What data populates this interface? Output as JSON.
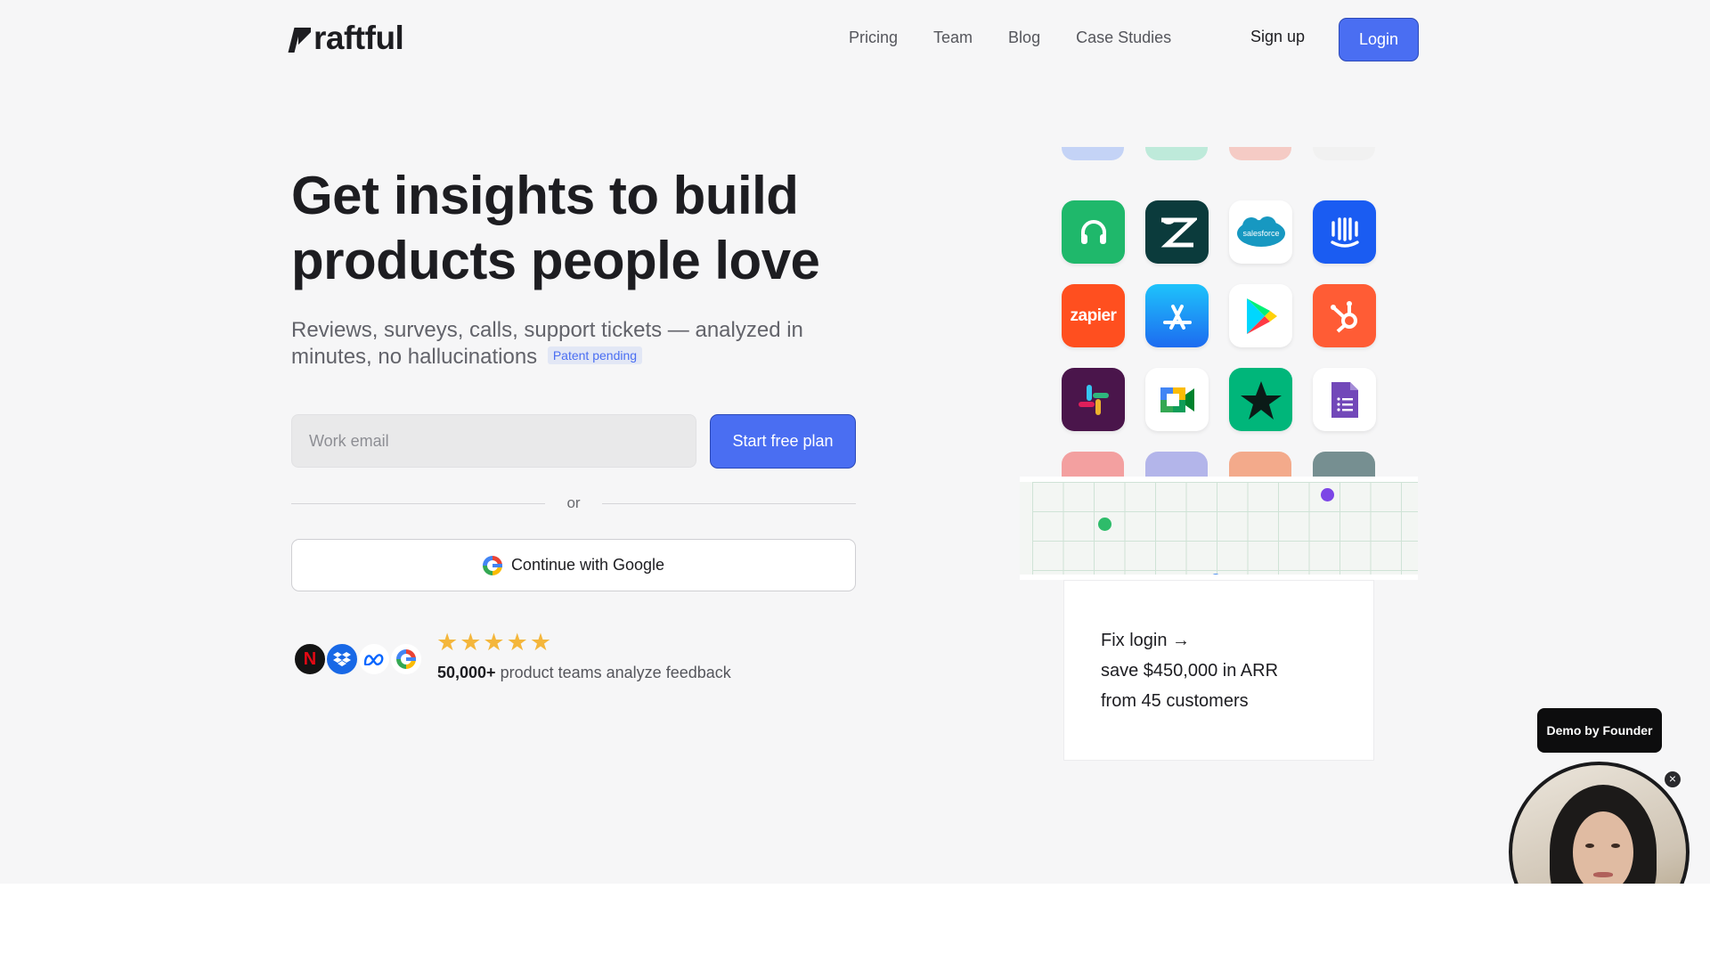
{
  "brand": {
    "name": "raftful"
  },
  "nav": {
    "links": [
      "Pricing",
      "Team",
      "Blog",
      "Case Studies"
    ],
    "signup_label": "Sign up",
    "login_label": "Login"
  },
  "hero": {
    "title": "Get insights to build products people love",
    "subtitle": "Reviews, surveys, calls, support tickets — analyzed in minutes, no hallucinations",
    "badge": "Patent pending",
    "email_placeholder": "Work email",
    "start_label": "Start free plan",
    "or_label": "or",
    "google_label": "Continue with Google"
  },
  "social_proof": {
    "logos": [
      "netflix-logo",
      "dropbox-logo",
      "meta-logo",
      "google-logo"
    ],
    "stars": "★★★★★",
    "rating": 5,
    "count": "50,000+",
    "text": "product teams analyze feedback"
  },
  "integrations": [
    "headset-icon",
    "zendesk-icon",
    "salesforce-icon",
    "intercom-icon",
    "zapier-icon",
    "app-store-icon",
    "google-play-icon",
    "hubspot-icon",
    "slack-icon",
    "google-meet-icon",
    "trustpilot-icon",
    "google-forms-icon"
  ],
  "integration_labels": {
    "salesforce": "salesforce",
    "zapier": "zapier"
  },
  "insight": {
    "line1": "Fix login →",
    "line2": "save $450,000 in ARR",
    "line3": "from 45 customers"
  },
  "demo": {
    "label": "Demo by Founder",
    "close": "×"
  },
  "colors": {
    "accent": "#4a6ef2",
    "background": "#f6f6f7",
    "text": "#1d1d21",
    "star": "#f4b63b"
  }
}
